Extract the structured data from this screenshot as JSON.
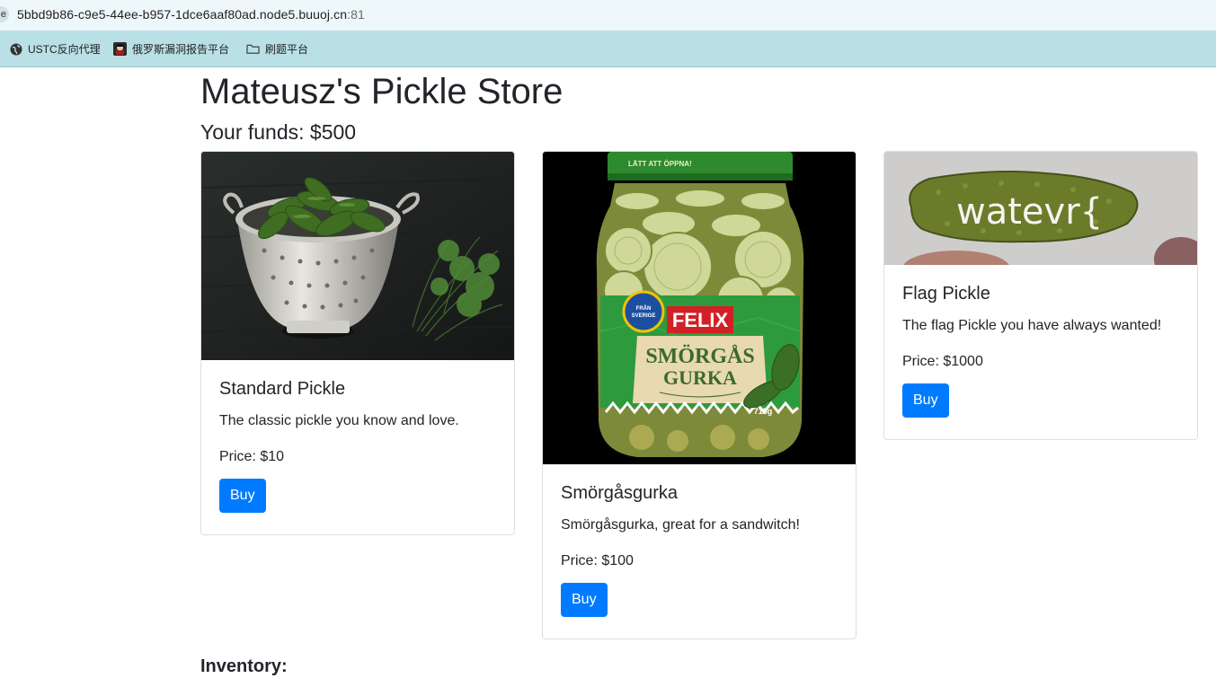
{
  "browser": {
    "url_host": "5bbd9b86-c9e5-44ee-b957-1dce6aaf80ad.node5.buuoj.cn",
    "url_port": ":81",
    "bookmarks": [
      {
        "label": "USTC反向代理",
        "icon": "globe-icon"
      },
      {
        "label": "俄罗斯漏洞报告平台",
        "icon": "site-favicon"
      },
      {
        "label": "刷题平台",
        "icon": "folder-icon"
      }
    ]
  },
  "page": {
    "title": "Mateusz's Pickle Store",
    "funds": "Your funds: $500",
    "inventory_label": "Inventory:"
  },
  "products": [
    {
      "name": "Standard Pickle",
      "description": "The classic pickle you know and love.",
      "price": "Price: $10",
      "buy_label": "Buy",
      "image": "pickles-in-colander"
    },
    {
      "name": "Smörgåsgurka",
      "description": "Smörgåsgurka, great for a sandwitch!",
      "price": "Price: $100",
      "buy_label": "Buy",
      "image": "felix-pickle-jar",
      "jar_text": {
        "brand": "FELIX",
        "line1": "SMÖRGÅS",
        "line2": "GURKA",
        "badge": "FRÅN SVERIGE",
        "weight": "715g",
        "lid": "LÄTT ATT ÖPPNA!"
      }
    },
    {
      "name": "Flag Pickle",
      "description": "The flag Pickle you have always wanted!",
      "price": "Price: $1000",
      "buy_label": "Buy",
      "image": "flag-pickle",
      "image_text": "watevr{"
    }
  ],
  "colors": {
    "accent": "#007bff",
    "bookmark_bar": "#b9e0e5"
  }
}
